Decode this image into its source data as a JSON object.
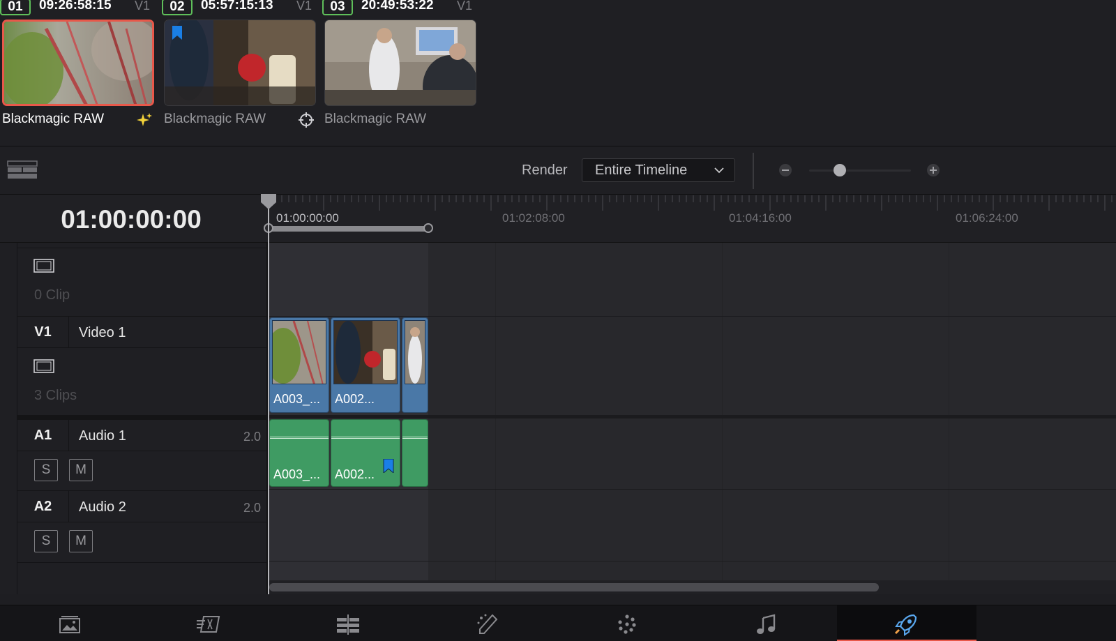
{
  "clips": [
    {
      "number": "01",
      "timecode": "09:26:58:15",
      "track": "V1",
      "codec": "Blackmagic RAW",
      "selected": true,
      "flag_color": null,
      "corner_icon": "sparkle-icon"
    },
    {
      "number": "02",
      "timecode": "05:57:15:13",
      "track": "V1",
      "codec": "Blackmagic RAW",
      "selected": false,
      "flag_color": "#1a7fe6",
      "corner_icon": "crosshair-icon"
    },
    {
      "number": "03",
      "timecode": "20:49:53:22",
      "track": "V1",
      "codec": "Blackmagic RAW",
      "selected": false,
      "flag_color": null,
      "corner_icon": null
    }
  ],
  "toolbar": {
    "render_label": "Render",
    "render_option": "Entire Timeline",
    "zoom_level": 0.3
  },
  "timeline": {
    "timecode": "01:00:00:00",
    "ruler_marks": [
      "01:00:00:00",
      "01:02:08:00",
      "01:04:16:00",
      "01:06:24:00"
    ],
    "tracks": {
      "empty_lane": {
        "clip_count": "0 Clip"
      },
      "v1": {
        "id": "V1",
        "name": "Video 1",
        "clip_count": "3 Clips"
      },
      "a1": {
        "id": "A1",
        "name": "Audio 1",
        "channels": "2.0",
        "solo": "S",
        "mute": "M"
      },
      "a2": {
        "id": "A2",
        "name": "Audio 2",
        "channels": "2.0",
        "solo": "S",
        "mute": "M"
      }
    },
    "video_clips": [
      "A003_...",
      "A002...",
      ""
    ],
    "audio_clips": [
      "A003_...",
      "A002...",
      ""
    ]
  },
  "pages": [
    "media-page",
    "cut-page",
    "edit-page",
    "fusion-page",
    "color-page",
    "fairlight-page",
    "deliver-page"
  ],
  "active_page": "deliver-page",
  "colors": {
    "accent": "#e8584a",
    "video_clip": "#4a78a7",
    "audio_clip": "#3f9b63",
    "flag": "#1a7fe6",
    "clip_number_border": "#f0a14a"
  }
}
